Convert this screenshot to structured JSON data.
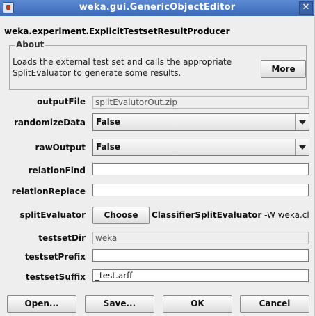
{
  "window": {
    "title": "weka.gui.GenericObjectEditor",
    "close_glyph": "✕",
    "app_icon": "java-cup-icon"
  },
  "class_name": "weka.experiment.ExplicitTestsetResultProducer",
  "about": {
    "legend": "About",
    "description": "Loads the external test set and calls the appropriate SplitEvaluator to generate some results.",
    "more_label": "More"
  },
  "properties": {
    "outputFile": {
      "label": "outputFile",
      "value": "splitEvalutorOut.zip"
    },
    "randomizeData": {
      "label": "randomizeData",
      "value": "False"
    },
    "rawOutput": {
      "label": "rawOutput",
      "value": "False"
    },
    "relationFind": {
      "label": "relationFind",
      "value": ""
    },
    "relationReplace": {
      "label": "relationReplace",
      "value": ""
    },
    "splitEvaluator": {
      "label": "splitEvaluator",
      "button_label": "Choose",
      "class_name": "ClassifierSplitEvaluator",
      "options": " -W weka.cl"
    },
    "testsetDir": {
      "label": "testsetDir",
      "value": "weka"
    },
    "testsetPrefix": {
      "label": "testsetPrefix",
      "value": ""
    },
    "testsetSuffix": {
      "label": "testsetSuffix",
      "value": "_test.arff"
    }
  },
  "buttons": {
    "open": "Open...",
    "save": "Save...",
    "ok": "OK",
    "cancel": "Cancel"
  },
  "colors": {
    "titlebar": "#4a78c5",
    "window_bg": "#eeeeee"
  }
}
